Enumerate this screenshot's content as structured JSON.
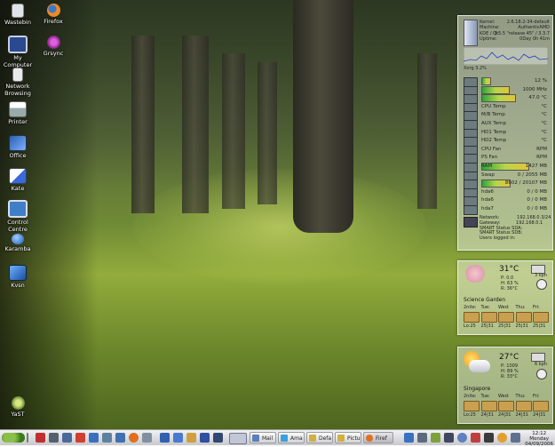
{
  "desktop_icons": [
    {
      "label": "Wastebin",
      "icon": "wastebin-icon"
    },
    {
      "label": "Firefox",
      "icon": "firefox-icon"
    },
    {
      "label": "My Computer",
      "icon": "computer-icon"
    },
    {
      "label": "Grsync",
      "icon": "grsync-icon"
    },
    {
      "label": "Network Browsing",
      "icon": "network-icon"
    },
    {
      "label": "Printer",
      "icon": "printer-icon"
    },
    {
      "label": "Office",
      "icon": "office-icon"
    },
    {
      "label": "Kate",
      "icon": "kate-icon"
    },
    {
      "label": "Control Centre",
      "icon": "control-centre-icon"
    },
    {
      "label": "Karamba",
      "icon": "karamba-icon"
    },
    {
      "label": "Kvsn",
      "icon": "kvsn-icon"
    },
    {
      "label": "YaST",
      "icon": "yast-icon"
    }
  ],
  "sysmon": {
    "header": {
      "kernel_label": "Kernel:",
      "kernel_value": "2.6.18.2-34-default",
      "machine_label": "Machine:",
      "machine_value": "AuthenticAMD",
      "kde_label": "KDE / Qt:",
      "kde_value": "3.5.5 \"release 45\" / 3.3.7",
      "uptime_label": "Uptime:",
      "uptime_value": "0Day 0h 41m"
    },
    "cpu_load": {
      "label": "Xorg",
      "value": "3.2%"
    },
    "rows": [
      {
        "label": "",
        "value": "12 %",
        "fill": 0.12
      },
      {
        "label": "",
        "value": "1000 MHz",
        "fill": 0.4
      },
      {
        "label": "",
        "value": "47.0 °C",
        "fill": 0.5
      },
      {
        "label": "CPU Temp",
        "value": "°C"
      },
      {
        "label": "M/B Temp",
        "value": "°C"
      },
      {
        "label": "AUX Temp",
        "value": "°C"
      },
      {
        "label": "HD1 Temp",
        "value": "°C"
      },
      {
        "label": "HD2 Temp",
        "value": "°C"
      },
      {
        "label": "CPU Fan",
        "value": "RPM"
      },
      {
        "label": "PS Fan",
        "value": "RPM"
      },
      {
        "label": "RAM",
        "value": "1427 MB",
        "fill": 0.7
      },
      {
        "label": "Swap",
        "value": "0 / 2055 MB"
      },
      {
        "label": "",
        "value": "8602 / 20107 MB",
        "fill": 0.42
      },
      {
        "label": "hda6",
        "value": "0 / 0 MB"
      },
      {
        "label": "hda6",
        "value": "0 / 0 MB"
      },
      {
        "label": "hda7",
        "value": "0 / 0 MB"
      }
    ],
    "network": {
      "net_label": "Network:",
      "net_value": "192.168.0.3/24",
      "gw_label": "Gateway:",
      "gw_value": "192.168.0.1",
      "smart_a": "SMART Status SDA:",
      "smart_b": "SMART Status SDB:",
      "users": "Users logged in:"
    }
  },
  "weather": [
    {
      "location": "Science Garden",
      "temp": "31°C",
      "p": "P: 0.0",
      "h": "H: 63 %",
      "r": "R: 36°C",
      "wind": "3 kph",
      "days": [
        "2nite:",
        "Tue:",
        "Wed:",
        "Thu:",
        "Fri:"
      ],
      "lows": [
        "Lo:25",
        "25|31",
        "25|31",
        "25|31",
        "25|31"
      ]
    },
    {
      "location": "Singapore",
      "temp": "27°C",
      "p": "P: 1009",
      "h": "H: 89 %",
      "r": "R: 33°C",
      "wind": "6 kph",
      "days": [
        "2nite:",
        "Tue:",
        "Wed:",
        "Thu:",
        "Fri:"
      ],
      "lows": [
        "Lo:25",
        "24|31",
        "24|31",
        "24|31",
        "24|31"
      ]
    }
  ],
  "taskbar": {
    "tasks": [
      "Mail",
      "Ama",
      "Defa",
      "Pictu",
      "Firef"
    ],
    "clock_time": "12:12",
    "clock_day": "Monday",
    "clock_date": "04/09/2006"
  },
  "colors": {
    "accent": "#5c7fb8",
    "bar_green": "#2ea33a"
  }
}
